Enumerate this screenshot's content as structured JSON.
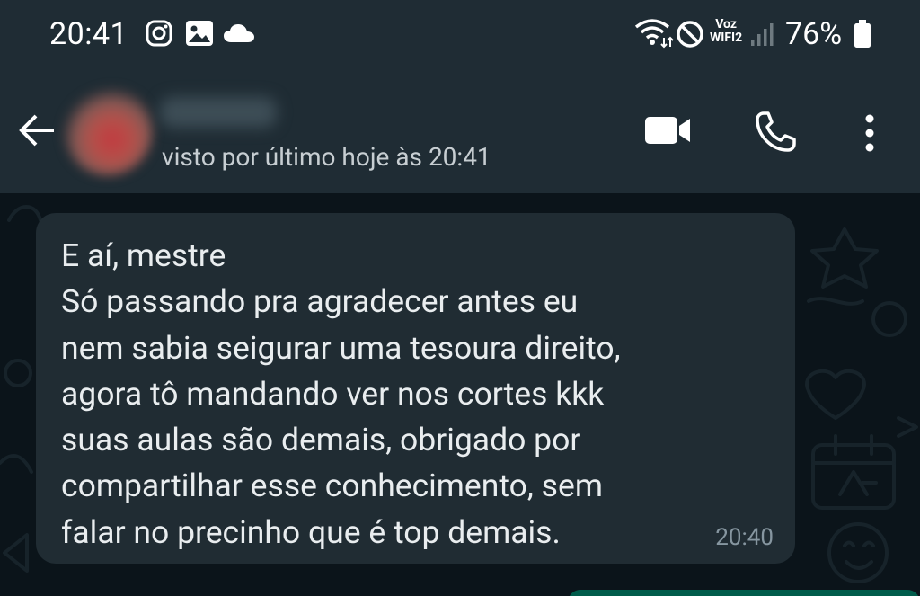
{
  "status_bar": {
    "time": "20:41",
    "voz_line1": "Voz",
    "voz_line2": "WIFI2",
    "battery": "76%",
    "icons": [
      "instagram-icon",
      "gallery-icon",
      "cloud-icon",
      "wifi-icon",
      "do-not-disturb-icon",
      "signal-icon",
      "battery-icon"
    ]
  },
  "header": {
    "last_seen": "visto por último hoje às 20:41",
    "icons": [
      "back-arrow-icon",
      "video-call-icon",
      "phone-call-icon",
      "more-options-icon"
    ]
  },
  "messages": [
    {
      "direction": "incoming",
      "text": "E aí, mestre\nSó passando pra agradecer antes eu\nnem sabia seigurar uma tesoura direito,\nagora tô mandando ver nos cortes kkk\nsuas aulas são demais, obrigado por\ncompartilhar esse conhecimento, sem\nfalar no precinho que é top demais.",
      "time": "20:40"
    }
  ],
  "colors": {
    "header_bg": "#1f2c34",
    "chat_bg": "#0b141a",
    "incoming_bubble": "#202c33",
    "outgoing_bubble": "#005c4b",
    "meta_text": "#8696a0"
  }
}
